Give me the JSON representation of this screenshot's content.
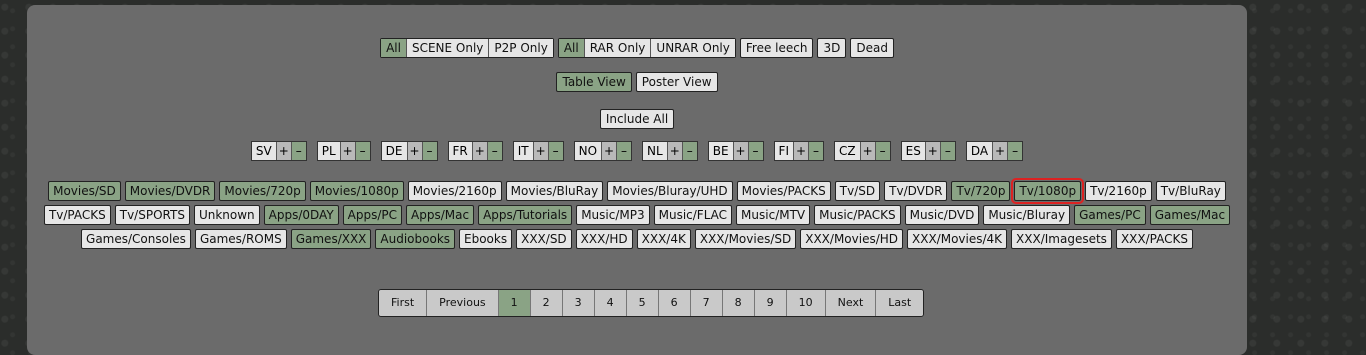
{
  "filters": {
    "release_group": [
      "All",
      "SCENE Only",
      "P2P Only"
    ],
    "archive_group": [
      "All",
      "RAR Only",
      "UNRAR Only"
    ],
    "free_leech": "Free leech",
    "threed": "3D",
    "dead": "Dead"
  },
  "views": [
    "Table View",
    "Poster View"
  ],
  "include_all": "Include All",
  "languages": [
    "SV",
    "PL",
    "DE",
    "FR",
    "IT",
    "NO",
    "NL",
    "BE",
    "FI",
    "CZ",
    "ES",
    "DA"
  ],
  "plus": "+",
  "minus": "–",
  "categories": [
    {
      "label": "Movies/SD",
      "on": true
    },
    {
      "label": "Movies/DVDR",
      "on": true
    },
    {
      "label": "Movies/720p",
      "on": true
    },
    {
      "label": "Movies/1080p",
      "on": true
    },
    {
      "label": "Movies/2160p",
      "on": false
    },
    {
      "label": "Movies/BluRay",
      "on": false
    },
    {
      "label": "Movies/Bluray/UHD",
      "on": false
    },
    {
      "label": "Movies/PACKS",
      "on": false
    },
    {
      "label": "Tv/SD",
      "on": false
    },
    {
      "label": "Tv/DVDR",
      "on": false
    },
    {
      "label": "Tv/720p",
      "on": true
    },
    {
      "label": "Tv/1080p",
      "on": true,
      "highlight": true
    },
    {
      "label": "Tv/2160p",
      "on": false
    },
    {
      "label": "Tv/BluRay",
      "on": false
    },
    {
      "label": "Tv/PACKS",
      "on": false
    },
    {
      "label": "Tv/SPORTS",
      "on": false
    },
    {
      "label": "Unknown",
      "on": false
    },
    {
      "label": "Apps/0DAY",
      "on": true
    },
    {
      "label": "Apps/PC",
      "on": true
    },
    {
      "label": "Apps/Mac",
      "on": true
    },
    {
      "label": "Apps/Tutorials",
      "on": true
    },
    {
      "label": "Music/MP3",
      "on": false
    },
    {
      "label": "Music/FLAC",
      "on": false
    },
    {
      "label": "Music/MTV",
      "on": false
    },
    {
      "label": "Music/PACKS",
      "on": false
    },
    {
      "label": "Music/DVD",
      "on": false
    },
    {
      "label": "Music/Bluray",
      "on": false
    },
    {
      "label": "Games/PC",
      "on": true
    },
    {
      "label": "Games/Mac",
      "on": true
    },
    {
      "label": "Games/Consoles",
      "on": false
    },
    {
      "label": "Games/ROMS",
      "on": false
    },
    {
      "label": "Games/XXX",
      "on": true
    },
    {
      "label": "Audiobooks",
      "on": true
    },
    {
      "label": "Ebooks",
      "on": false
    },
    {
      "label": "XXX/SD",
      "on": false
    },
    {
      "label": "XXX/HD",
      "on": false
    },
    {
      "label": "XXX/4K",
      "on": false
    },
    {
      "label": "XXX/Movies/SD",
      "on": false
    },
    {
      "label": "XXX/Movies/HD",
      "on": false
    },
    {
      "label": "XXX/Movies/4K",
      "on": false
    },
    {
      "label": "XXX/Imagesets",
      "on": false
    },
    {
      "label": "XXX/PACKS",
      "on": false
    }
  ],
  "pager": {
    "items": [
      "First",
      "Previous",
      "1",
      "2",
      "3",
      "4",
      "5",
      "6",
      "7",
      "8",
      "9",
      "10",
      "Next",
      "Last"
    ],
    "current": "1"
  },
  "colors": {
    "active": "#8aa385",
    "inactive": "#e6e6e6",
    "highlight": "#dd2222"
  }
}
